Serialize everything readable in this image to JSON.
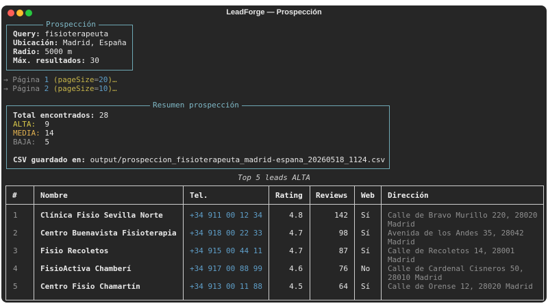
{
  "window": {
    "title": "LeadForge — Prospección"
  },
  "query_panel": {
    "title": "Prospección",
    "rows": [
      {
        "key": "Query:",
        "value": "fisioterapeuta"
      },
      {
        "key": "Ubicación:",
        "value": "Madrid, España"
      },
      {
        "key": "Radio:",
        "value": "5000 m"
      },
      {
        "key": "Máx. resultados:",
        "value": "30"
      }
    ]
  },
  "pages": [
    {
      "arrow": "→",
      "text": "Página",
      "num": "1",
      "open": "(",
      "size_key": "pageSize",
      "eq": "=",
      "size": "20",
      "close": ")…"
    },
    {
      "arrow": "→",
      "text": "Página",
      "num": "2",
      "open": "(",
      "size_key": "pageSize",
      "eq": "=",
      "size": "10",
      "close": ")…"
    }
  ],
  "summary": {
    "title": "Resumen prospección",
    "total_label": "Total encontrados:",
    "total": "28",
    "alta_label": "ALTA:",
    "alta": "9",
    "media_label": "MEDIA:",
    "media": "14",
    "baja_label": "BAJA:",
    "baja": "5",
    "csv_label": "CSV guardado en:",
    "csv_path": "output/prospeccion_fisioterapeuta_madrid-espana_20260518_1124.csv"
  },
  "table": {
    "caption": "Top 5 leads ALTA",
    "headers": [
      "#",
      "Nombre",
      "Tel.",
      "Rating",
      "Reviews",
      "Web",
      "Dirección"
    ],
    "rows": [
      {
        "n": "1",
        "name": "Clínica Fisio Sevilla Norte",
        "tel": "+34 911 00 12 34",
        "rating": "4.8",
        "reviews": "142",
        "web": "Sí",
        "dir1": "Calle de Bravo Murillo 220, 28020",
        "dir2": "Madrid"
      },
      {
        "n": "2",
        "name": "Centro Buenavista Fisioterapia",
        "tel": "+34 918 00 22 33",
        "rating": "4.7",
        "reviews": "98",
        "web": "Sí",
        "dir1": "Avenida de los Andes 35, 28042",
        "dir2": "Madrid"
      },
      {
        "n": "3",
        "name": "Fisio Recoletos",
        "tel": "+34 915 00 44 11",
        "rating": "4.7",
        "reviews": "87",
        "web": "Sí",
        "dir1": "Calle de Recoletos 14, 28001",
        "dir2": "Madrid"
      },
      {
        "n": "4",
        "name": "FisioActiva Chamberí",
        "tel": "+34 917 00 88 99",
        "rating": "4.6",
        "reviews": "76",
        "web": "No",
        "dir1": "Calle de Cardenal Cisneros 50,",
        "dir2": "28010 Madrid"
      },
      {
        "n": "5",
        "name": "Centro Fisio Chamartín",
        "tel": "+34 913 00 11 88",
        "rating": "4.5",
        "reviews": "64",
        "web": "Sí",
        "dir1": "Calle de Orense 12, 28020 Madrid",
        "dir2": ""
      }
    ]
  }
}
